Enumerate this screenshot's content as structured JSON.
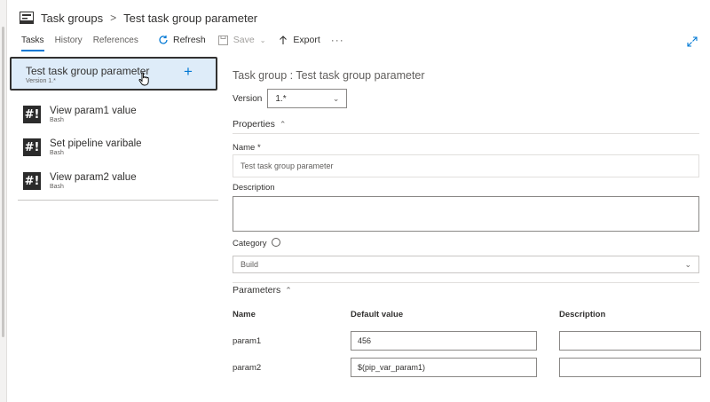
{
  "header": {
    "breadcrumb": [
      "Task groups",
      "Test task group parameter"
    ]
  },
  "tabs": [
    {
      "label": "Tasks",
      "active": true
    },
    {
      "label": "History",
      "active": false
    },
    {
      "label": "References",
      "active": false
    }
  ],
  "toolbar": {
    "refresh_label": "Refresh",
    "save_label": "Save",
    "export_label": "Export",
    "more_label": "···"
  },
  "task_list": {
    "selected": {
      "title": "Test task group parameter",
      "subtitle": "Version 1.*"
    },
    "tasks": [
      {
        "title": "View param1 value",
        "subtitle": "Bash",
        "icon": "#!"
      },
      {
        "title": "Set pipeline varibale",
        "subtitle": "Bash",
        "icon": "#!"
      },
      {
        "title": "View param2 value",
        "subtitle": "Bash",
        "icon": "#!"
      }
    ]
  },
  "panel": {
    "title": "Task group : Test task group parameter",
    "version_label": "Version",
    "version_value": "1.*",
    "properties_label": "Properties",
    "name_label": "Name *",
    "name_value": "Test task group parameter",
    "description_label": "Description",
    "description_value": "",
    "category_label": "Category",
    "category_value": "Build",
    "parameters_label": "Parameters",
    "param_headers": [
      "Name",
      "Default value",
      "Description"
    ],
    "params": [
      {
        "name": "param1",
        "default": "456",
        "description": ""
      },
      {
        "name": "param2",
        "default": "$(pip_var_param1)",
        "description": ""
      }
    ]
  },
  "colors": {
    "accent": "#0078d4",
    "selected_bg": "#deecf9"
  }
}
